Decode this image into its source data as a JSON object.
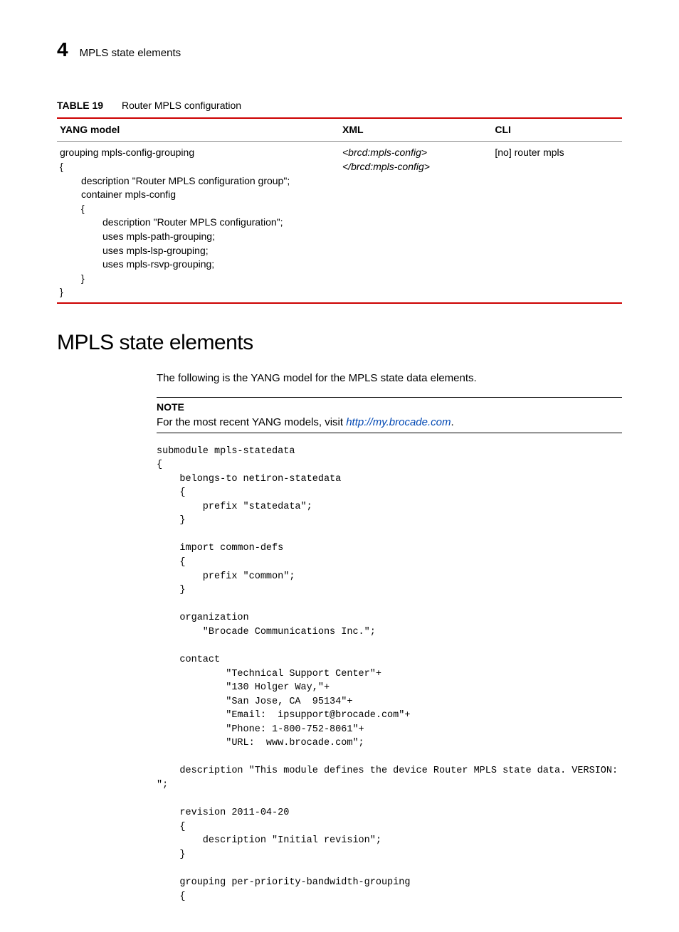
{
  "header": {
    "chapter_number": "4",
    "chapter_title": "MPLS state elements"
  },
  "table": {
    "label": "TABLE 19",
    "caption": "Router MPLS configuration",
    "cols": {
      "yang": "YANG model",
      "xml": "XML",
      "cli": "CLI"
    },
    "yang_lines": [
      {
        "indent": 0,
        "text": "grouping mpls-config-grouping"
      },
      {
        "indent": 0,
        "text": "{"
      },
      {
        "indent": 1,
        "text": "description \"Router MPLS configuration group\";"
      },
      {
        "indent": 1,
        "text": "container mpls-config"
      },
      {
        "indent": 1,
        "text": "{"
      },
      {
        "indent": 2,
        "text": "description \"Router MPLS configuration\";"
      },
      {
        "indent": 2,
        "text": "uses mpls-path-grouping;"
      },
      {
        "indent": 2,
        "text": "uses mpls-lsp-grouping;"
      },
      {
        "indent": 2,
        "text": "uses mpls-rsvp-grouping;"
      },
      {
        "indent": 1,
        "text": "}"
      },
      {
        "indent": 0,
        "text": "}"
      }
    ],
    "xml_lines": [
      "<brcd:mpls-config>",
      "</brcd:mpls-config>"
    ],
    "cli": "[no] router mpls"
  },
  "section": {
    "heading": "MPLS state elements",
    "intro": "The following is the YANG model for the MPLS state data elements.",
    "note": {
      "label": "NOTE",
      "text_prefix": "For the most recent YANG models, visit ",
      "link_text": "http://my.brocade.com",
      "text_suffix": "."
    },
    "code": "submodule mpls-statedata\n{\n    belongs-to netiron-statedata\n    {\n        prefix \"statedata\";\n    }\n\n    import common-defs\n    {\n        prefix \"common\";\n    }\n\n    organization\n        \"Brocade Communications Inc.\";\n\n    contact\n            \"Technical Support Center\"+\n            \"130 Holger Way,\"+\n            \"San Jose, CA  95134\"+\n            \"Email:  ipsupport@brocade.com\"+\n            \"Phone: 1-800-752-8061\"+\n            \"URL:  www.brocade.com\";\n\n    description \"This module defines the device Router MPLS state data. VERSION: \n\";\n\n    revision 2011-04-20\n    {\n        description \"Initial revision\";\n    }\n\n    grouping per-priority-bandwidth-grouping\n    {"
  }
}
